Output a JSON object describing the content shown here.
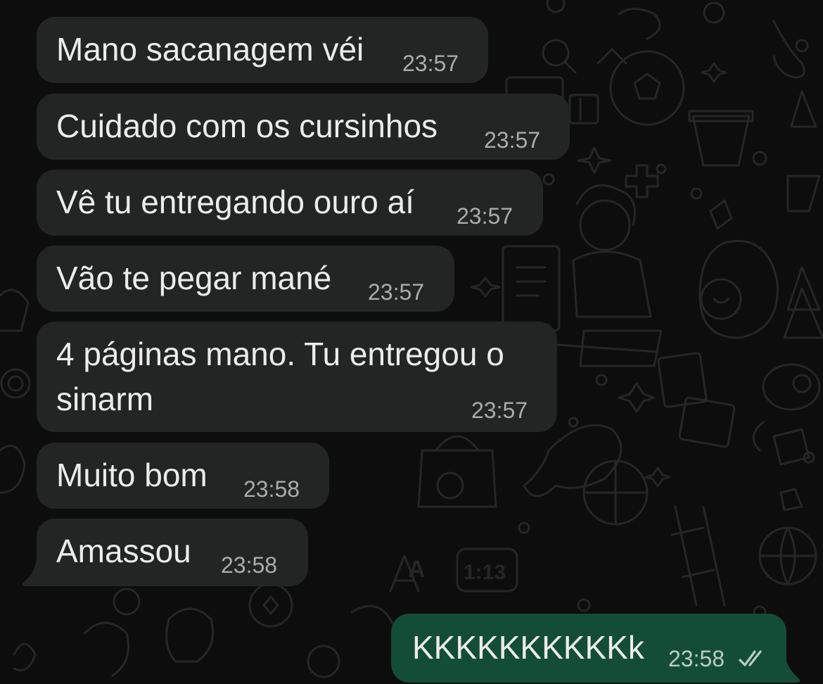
{
  "theme": {
    "incoming_bubble": "#232524",
    "outgoing_bubble": "#144d37",
    "background": "#0d0d0d",
    "wallpaper_doodle": "#262626"
  },
  "messages": [
    {
      "direction": "incoming",
      "text": "Mano sacanagem véi",
      "time": "23:57"
    },
    {
      "direction": "incoming",
      "text": "Cuidado com os cursinhos",
      "time": "23:57"
    },
    {
      "direction": "incoming",
      "text": "Vê tu entregando ouro aí",
      "time": "23:57"
    },
    {
      "direction": "incoming",
      "text": "Vão te pegar mané",
      "time": "23:57"
    },
    {
      "direction": "incoming",
      "text_line1": "4 páginas mano. Tu entregou o",
      "text_line2": "sinarm",
      "time": "23:57"
    },
    {
      "direction": "incoming",
      "text": "Muito bom",
      "time": "23:58"
    },
    {
      "direction": "incoming",
      "text": "Amassou",
      "time": "23:58"
    },
    {
      "direction": "outgoing",
      "text": "KKKKKKKKKKk",
      "time": "23:58",
      "status_icon": "double-check-icon",
      "status": "read"
    }
  ],
  "wallpaper": {
    "clock_doodle_text": "1:13",
    "letter_doodle_text": "A"
  }
}
